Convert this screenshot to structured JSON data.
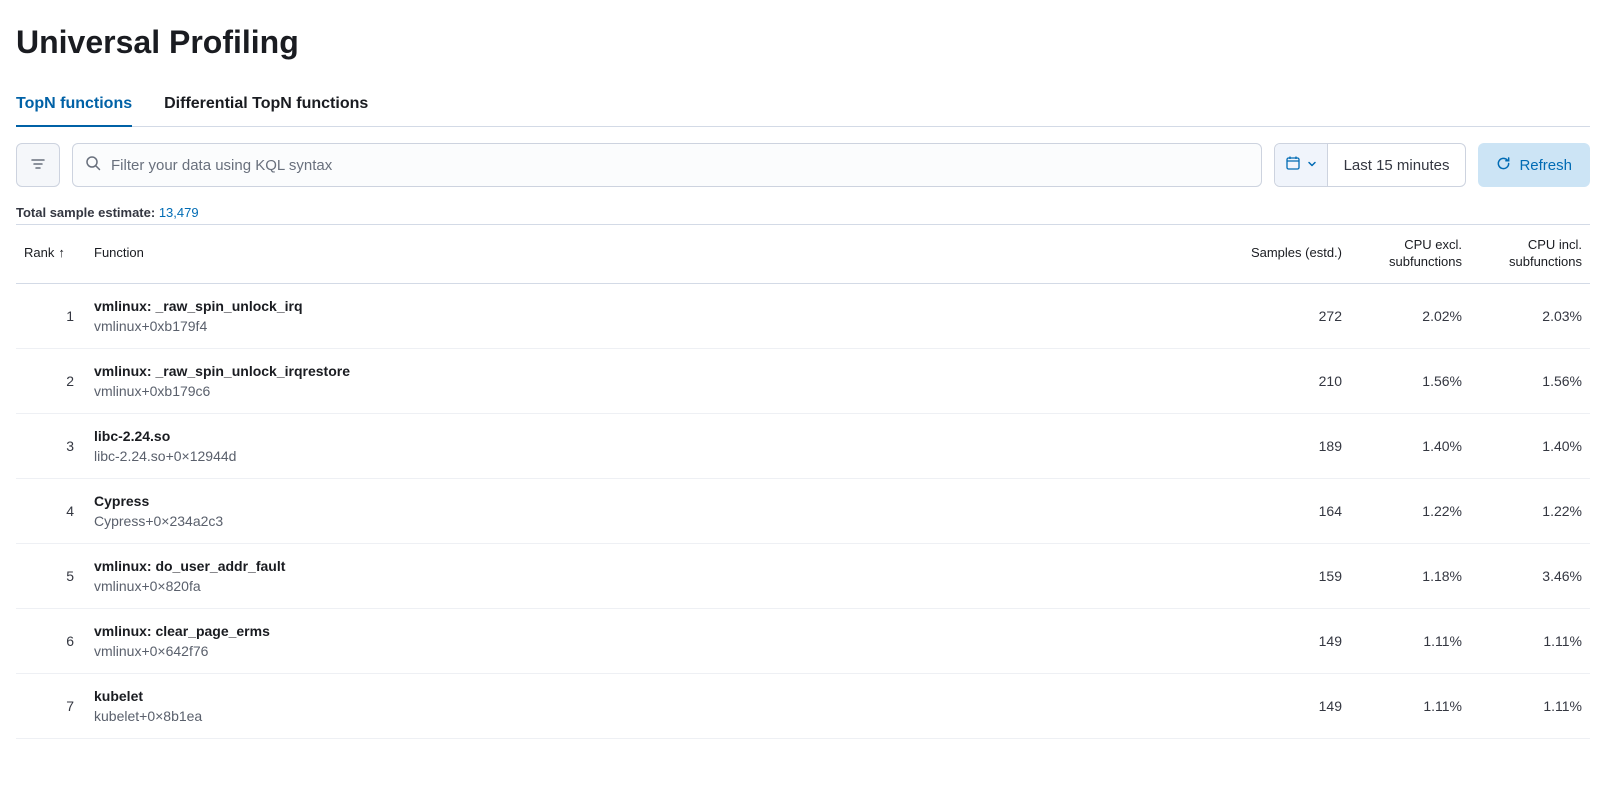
{
  "page_title": "Universal Profiling",
  "tabs": [
    {
      "label": "TopN functions",
      "active": true
    },
    {
      "label": "Differential TopN functions",
      "active": false
    }
  ],
  "search": {
    "placeholder": "Filter your data using KQL syntax"
  },
  "date_range": {
    "label": "Last 15 minutes"
  },
  "refresh_label": "Refresh",
  "estimate": {
    "prefix": "Total sample estimate:",
    "value": "13,479"
  },
  "columns": {
    "rank": "Rank",
    "function": "Function",
    "samples": "Samples (estd.)",
    "excl": "CPU excl. subfunctions",
    "incl": "CPU incl. subfunctions"
  },
  "rows": [
    {
      "rank": "1",
      "name": "vmlinux: _raw_spin_unlock_irq",
      "sub": "vmlinux+0xb179f4",
      "samples": "272",
      "excl": "2.02%",
      "incl": "2.03%"
    },
    {
      "rank": "2",
      "name": "vmlinux: _raw_spin_unlock_irqrestore",
      "sub": "vmlinux+0xb179c6",
      "samples": "210",
      "excl": "1.56%",
      "incl": "1.56%"
    },
    {
      "rank": "3",
      "name": "libc-2.24.so",
      "sub": "libc-2.24.so+0×12944d",
      "samples": "189",
      "excl": "1.40%",
      "incl": "1.40%"
    },
    {
      "rank": "4",
      "name": "Cypress",
      "sub": "Cypress+0×234a2c3",
      "samples": "164",
      "excl": "1.22%",
      "incl": "1.22%"
    },
    {
      "rank": "5",
      "name": "vmlinux: do_user_addr_fault",
      "sub": "vmlinux+0×820fa",
      "samples": "159",
      "excl": "1.18%",
      "incl": "3.46%"
    },
    {
      "rank": "6",
      "name": "vmlinux: clear_page_erms",
      "sub": "vmlinux+0×642f76",
      "samples": "149",
      "excl": "1.11%",
      "incl": "1.11%"
    },
    {
      "rank": "7",
      "name": "kubelet",
      "sub": "kubelet+0×8b1ea",
      "samples": "149",
      "excl": "1.11%",
      "incl": "1.11%"
    }
  ]
}
